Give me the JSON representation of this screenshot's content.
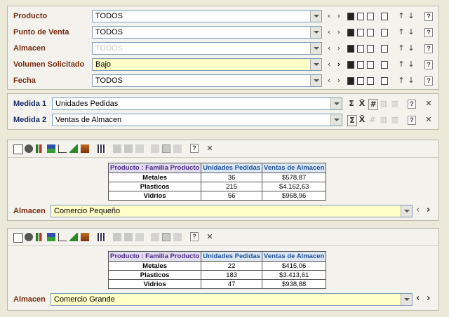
{
  "filters": [
    {
      "label": "Producto",
      "value": "TODOS",
      "style": "white",
      "disabled": false
    },
    {
      "label": "Punto de Venta",
      "value": "TODOS",
      "style": "white",
      "disabled": false
    },
    {
      "label": "Almacen",
      "value": "TODOS",
      "style": "white",
      "disabled": true
    },
    {
      "label": "Volumen Solicitado",
      "value": "Bajo",
      "style": "yellow",
      "disabled": false
    },
    {
      "label": "Fecha",
      "value": "TODOS",
      "style": "white",
      "disabled": false
    }
  ],
  "measures": [
    {
      "label": "Medida 1",
      "value": "Unidades Pedidas"
    },
    {
      "label": "Medida 2",
      "value": "Ventas de Almacen"
    }
  ],
  "measure_icons": {
    "sum": "Σ",
    "avg": "X̄",
    "count": "#"
  },
  "tables": [
    {
      "headers": [
        "Producto : Familia Producto",
        "Unidades Pedidas",
        "Ventas de Almacen"
      ],
      "rows": [
        [
          "Metales",
          "36",
          "$578,87"
        ],
        [
          "Plasticos",
          "215",
          "$4.162,63"
        ],
        [
          "Vidrios",
          "56",
          "$968,96"
        ]
      ],
      "footer_label": "Almacen",
      "footer_value": "Comercio Pequeño"
    },
    {
      "headers": [
        "Producto : Familia Producto",
        "Unidades Pedidas",
        "Ventas de Almacen"
      ],
      "rows": [
        [
          "Metales",
          "22",
          "$415,06"
        ],
        [
          "Plasticos",
          "183",
          "$3.413,61"
        ],
        [
          "Vidrios",
          "47",
          "$938,88"
        ]
      ],
      "footer_label": "Almacen",
      "footer_value": "Comercio Grande"
    }
  ],
  "glyphs": {
    "prev": "‹",
    "next": "›",
    "up": "↑",
    "down": "↓",
    "help": "?",
    "close": "✕"
  },
  "colors": {
    "label_red": "#7a2c12",
    "label_blue": "#1a2d6b",
    "header_purple": "#4b2a87",
    "header_blue": "#1e4f9a",
    "yellow_field": "#ffffc8"
  }
}
